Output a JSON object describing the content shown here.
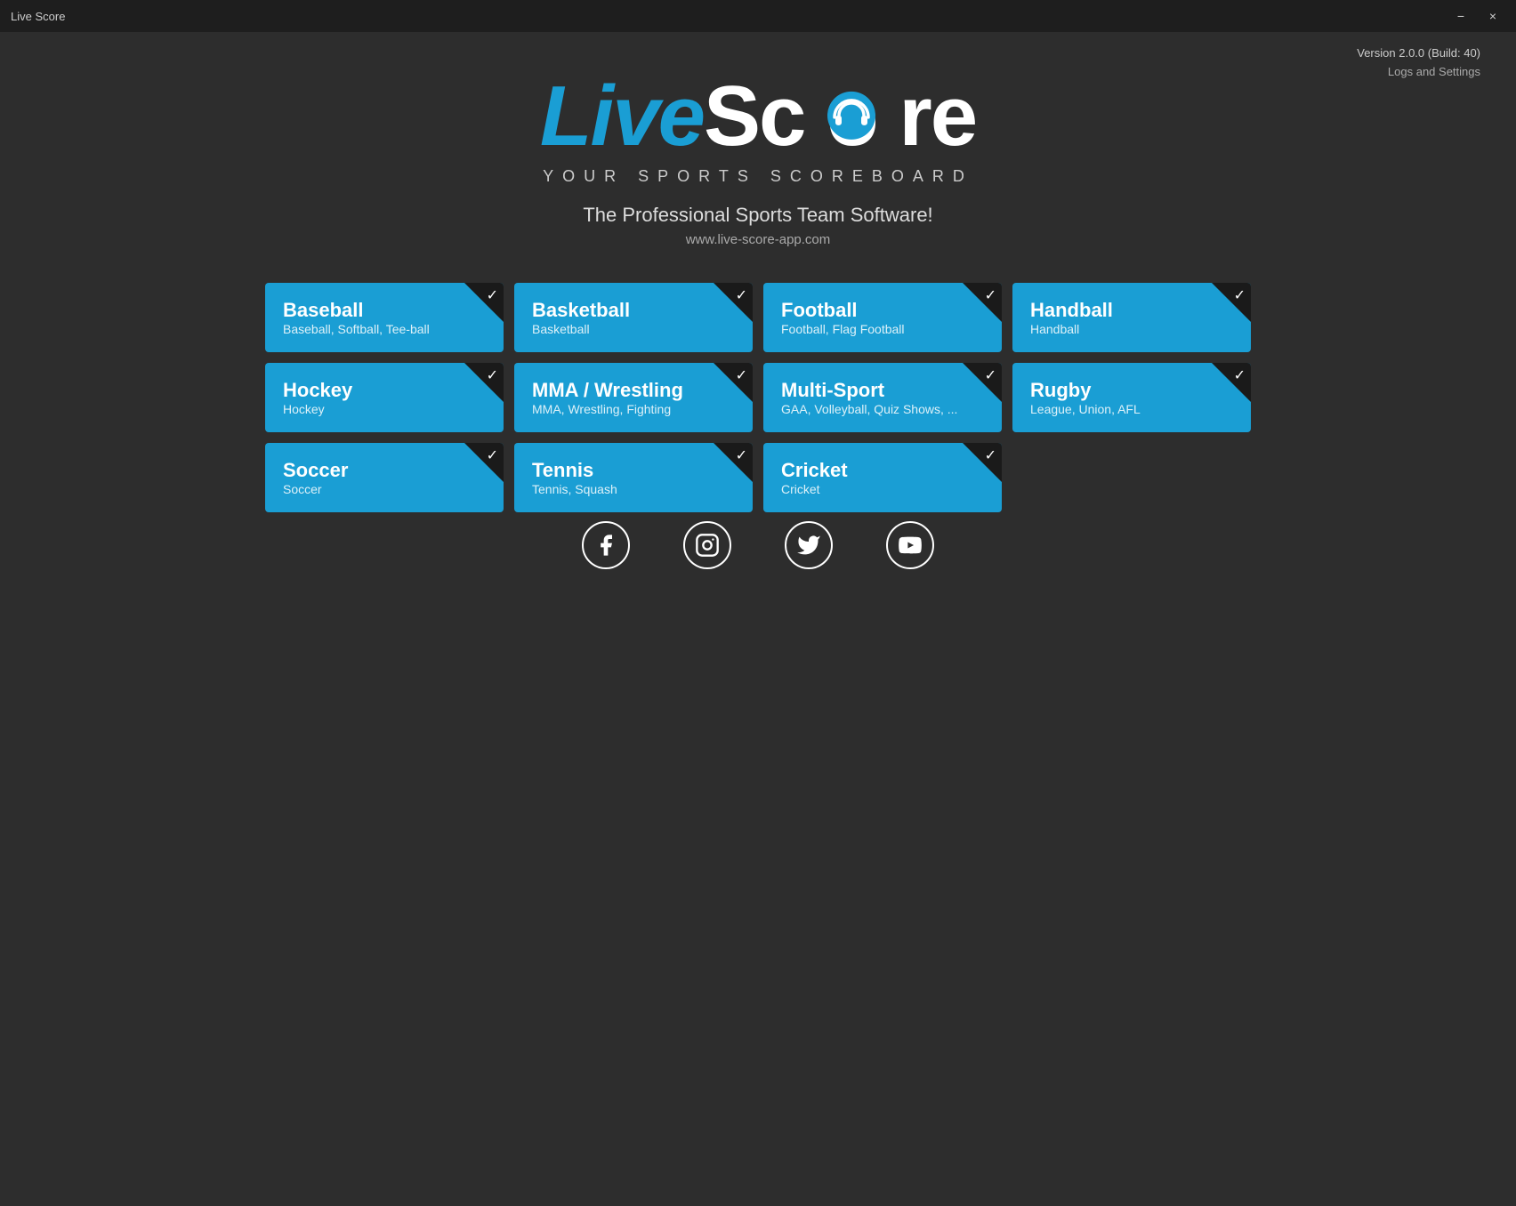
{
  "titleBar": {
    "title": "Live Score",
    "minimizeLabel": "−",
    "closeLabel": "×"
  },
  "versionInfo": {
    "version": "Version 2.0.0 (Build: 40)",
    "logsSettings": "Logs and Settings"
  },
  "logo": {
    "live": "Live",
    "score": "Sc",
    "re": "re"
  },
  "tagline": "YOUR SPORTS SCOREBOARD",
  "promoText": "The Professional Sports Team Software!",
  "website": "www.live-score-app.com",
  "sports": [
    {
      "id": "baseball",
      "name": "Baseball",
      "subtitle": "Baseball, Softball, Tee-ball",
      "checked": true
    },
    {
      "id": "basketball",
      "name": "Basketball",
      "subtitle": "Basketball",
      "checked": true
    },
    {
      "id": "football",
      "name": "Football",
      "subtitle": "Football, Flag Football",
      "checked": true
    },
    {
      "id": "handball",
      "name": "Handball",
      "subtitle": "Handball",
      "checked": true
    },
    {
      "id": "hockey",
      "name": "Hockey",
      "subtitle": "Hockey",
      "checked": true
    },
    {
      "id": "mma-wrestling",
      "name": "MMA / Wrestling",
      "subtitle": "MMA, Wrestling, Fighting",
      "checked": true
    },
    {
      "id": "multi-sport",
      "name": "Multi-Sport",
      "subtitle": "GAA, Volleyball, Quiz Shows, ...",
      "checked": true
    },
    {
      "id": "rugby",
      "name": "Rugby",
      "subtitle": "League, Union, AFL",
      "checked": true
    },
    {
      "id": "soccer",
      "name": "Soccer",
      "subtitle": "Soccer",
      "checked": true
    },
    {
      "id": "tennis",
      "name": "Tennis",
      "subtitle": "Tennis, Squash",
      "checked": true
    },
    {
      "id": "cricket",
      "name": "Cricket",
      "subtitle": "Cricket",
      "checked": true
    }
  ],
  "social": [
    {
      "id": "facebook",
      "icon": "f",
      "label": "Facebook"
    },
    {
      "id": "instagram",
      "icon": "inst",
      "label": "Instagram"
    },
    {
      "id": "twitter",
      "icon": "tw",
      "label": "Twitter"
    },
    {
      "id": "youtube",
      "icon": "yt",
      "label": "YouTube"
    }
  ]
}
